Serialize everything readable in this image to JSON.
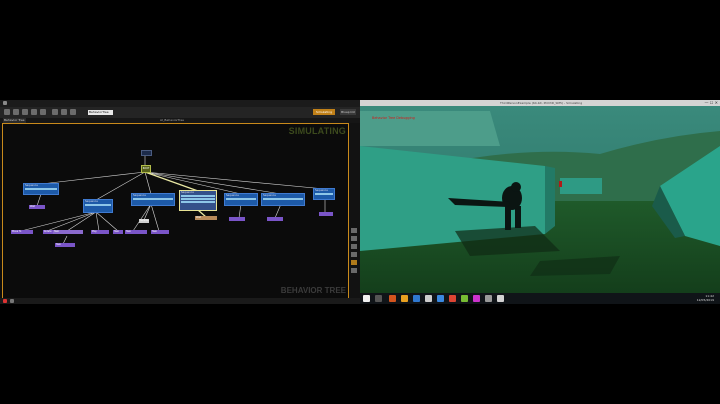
{
  "editor": {
    "search_value": "BehaviorTree",
    "simulating_button": "Simulating",
    "blueprint_button": "Blueprint",
    "tab_label": "Behavior Tree",
    "graph_title": "AI_BehaviorTree",
    "simulating_label": "SIMULATING",
    "watermark": "BEHAVIOR TREE",
    "root": "ROOT",
    "selector": "Selector",
    "composites": [
      "Sequence",
      "Sequence",
      "Sequence",
      "Sequence",
      "Sequence",
      "Sequence",
      "Sequence",
      "Sequence"
    ],
    "service": "Service",
    "tasks": [
      "Wait",
      "Move To",
      "Rotate",
      "Task",
      "Play",
      "Task",
      "Task",
      "Task",
      "Task",
      "Wait"
    ],
    "frame_colors": {
      "accent": "#c98a1b",
      "composite": "#1d5aa8",
      "task": "#7a55c8",
      "root": "#56601a"
    }
  },
  "game": {
    "window_title": "ThirdPersonExample (64-bit, PCD3D_SM5) - Simulating",
    "debug_text": "Behavior Tree Debugging",
    "window_buttons": "—  ☐  ✕",
    "clock_time": "11:42",
    "clock_date": "12/05/2019"
  }
}
